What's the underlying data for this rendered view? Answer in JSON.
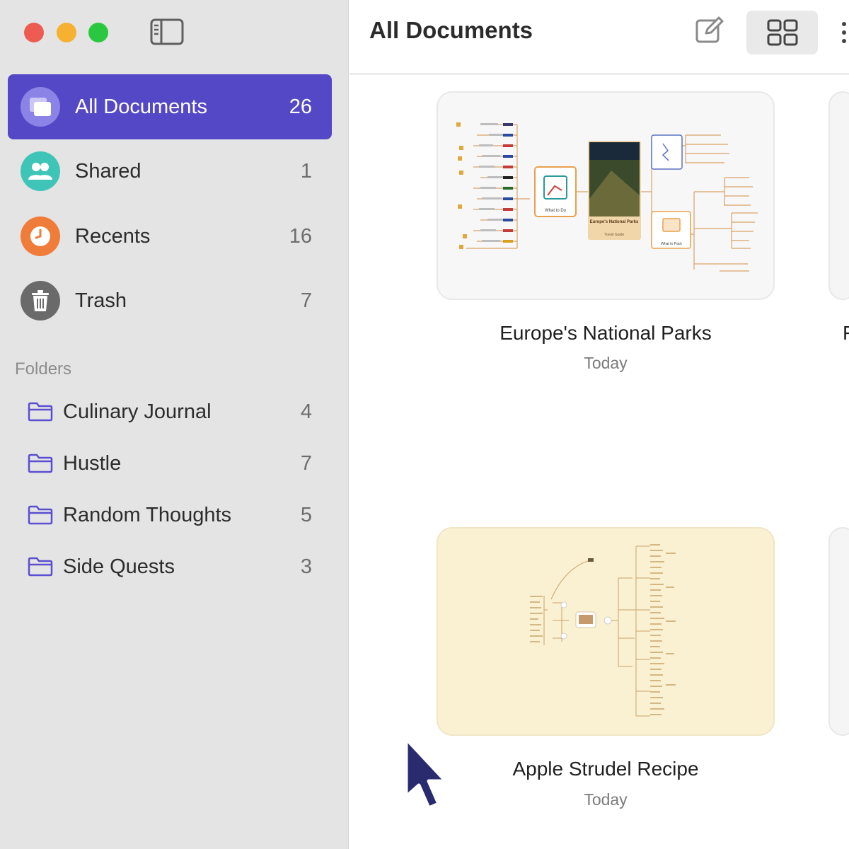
{
  "sidebar": {
    "nav": [
      {
        "label": "All Documents",
        "count": "26",
        "icon": "all-documents-icon",
        "color": "#8b84e6"
      },
      {
        "label": "Shared",
        "count": "1",
        "icon": "people-icon",
        "color": "#3fc5b8"
      },
      {
        "label": "Recents",
        "count": "16",
        "icon": "clock-icon",
        "color": "#f07c3a"
      },
      {
        "label": "Trash",
        "count": "7",
        "icon": "trash-icon",
        "color": "#6a6a6a"
      }
    ],
    "folders_heading": "Folders",
    "folders": [
      {
        "label": "Culinary Journal",
        "count": "4"
      },
      {
        "label": "Hustle",
        "count": "7"
      },
      {
        "label": "Random Thoughts",
        "count": "5"
      },
      {
        "label": "Side Quests",
        "count": "3"
      }
    ],
    "active_color": "#5448c6"
  },
  "main": {
    "title": "All Documents",
    "documents": [
      {
        "title": "Europe's National Parks",
        "date": "Today",
        "thumb_labels": {
          "node_what_to_do": "What to Do",
          "node_center": "Europe's National Parks",
          "node_center_sub": "Travel Guide",
          "node_what_to_pack": "What to Pack"
        }
      },
      {
        "title": "Apple Strudel Recipe",
        "date": "Today"
      }
    ],
    "partial_title": "F"
  }
}
